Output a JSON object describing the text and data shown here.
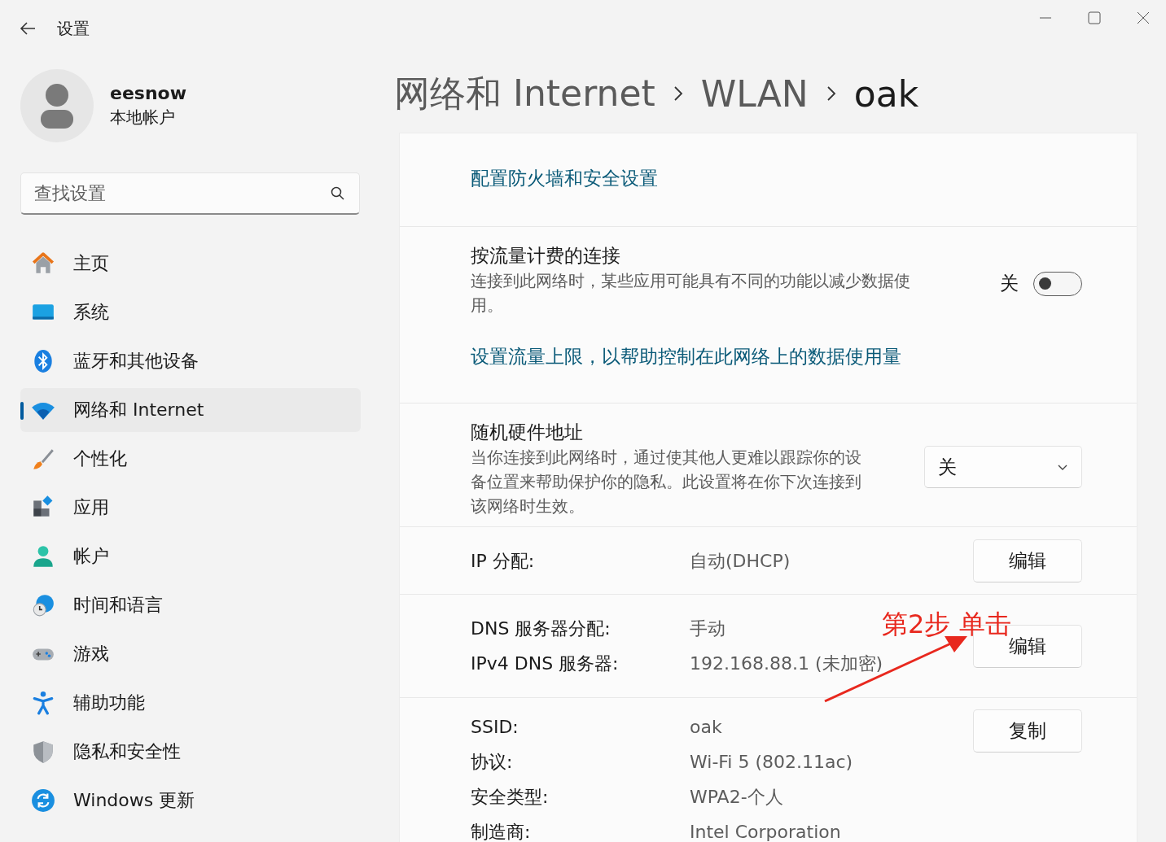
{
  "window": {
    "title": "设置"
  },
  "profile": {
    "name": "eesnow",
    "account_type": "本地帐户"
  },
  "search": {
    "placeholder": "查找设置"
  },
  "nav": [
    {
      "label": "主页",
      "kind": "home",
      "selected": false
    },
    {
      "label": "系统",
      "kind": "system",
      "selected": false
    },
    {
      "label": "蓝牙和其他设备",
      "kind": "bluetooth",
      "selected": false
    },
    {
      "label": "网络和 Internet",
      "kind": "network",
      "selected": true
    },
    {
      "label": "个性化",
      "kind": "personalization",
      "selected": false
    },
    {
      "label": "应用",
      "kind": "apps",
      "selected": false
    },
    {
      "label": "帐户",
      "kind": "accounts",
      "selected": false
    },
    {
      "label": "时间和语言",
      "kind": "time",
      "selected": false
    },
    {
      "label": "游戏",
      "kind": "gaming",
      "selected": false
    },
    {
      "label": "辅助功能",
      "kind": "accessibility",
      "selected": false
    },
    {
      "label": "隐私和安全性",
      "kind": "privacy",
      "selected": false
    },
    {
      "label": "Windows 更新",
      "kind": "update",
      "selected": false
    }
  ],
  "breadcrumb": [
    "网络和 Internet",
    "WLAN",
    "oak"
  ],
  "sections": [
    {
      "kind": "link",
      "link": "配置防火墙和安全设置"
    },
    {
      "kind": "toggle",
      "title": "按流量计费的连接",
      "description": "连接到此网络时，某些应用可能具有不同的功能以减少数据使用。",
      "state_label": "关",
      "on": false,
      "link": "设置流量上限，以帮助控制在此网络上的数据使用量"
    },
    {
      "kind": "dropdown",
      "title": "随机硬件地址",
      "description": "当你连接到此网络时，通过使其他人更难以跟踪你的设备位置来帮助保护你的隐私。此设置将在你下次连接到该网络时生效。",
      "value": "关"
    },
    {
      "kind": "properties",
      "rows": [
        {
          "label": "IP 分配:",
          "value": "自动(DHCP)"
        }
      ],
      "button": "编辑"
    },
    {
      "kind": "properties",
      "rows": [
        {
          "label": "DNS 服务器分配:",
          "value": "手动"
        },
        {
          "label": "IPv4 DNS 服务器:",
          "value": "192.168.88.1 (未加密)"
        }
      ],
      "button": "编辑"
    },
    {
      "kind": "properties",
      "rows": [
        {
          "label": "SSID:",
          "value": "oak"
        },
        {
          "label": "协议:",
          "value": "Wi-Fi 5 (802.11ac)"
        },
        {
          "label": "安全类型:",
          "value": "WPA2-个人"
        },
        {
          "label": "制造商:",
          "value": "Intel Corporation"
        }
      ],
      "button": "复制"
    }
  ],
  "annotation": {
    "text": "第2步 单击"
  }
}
